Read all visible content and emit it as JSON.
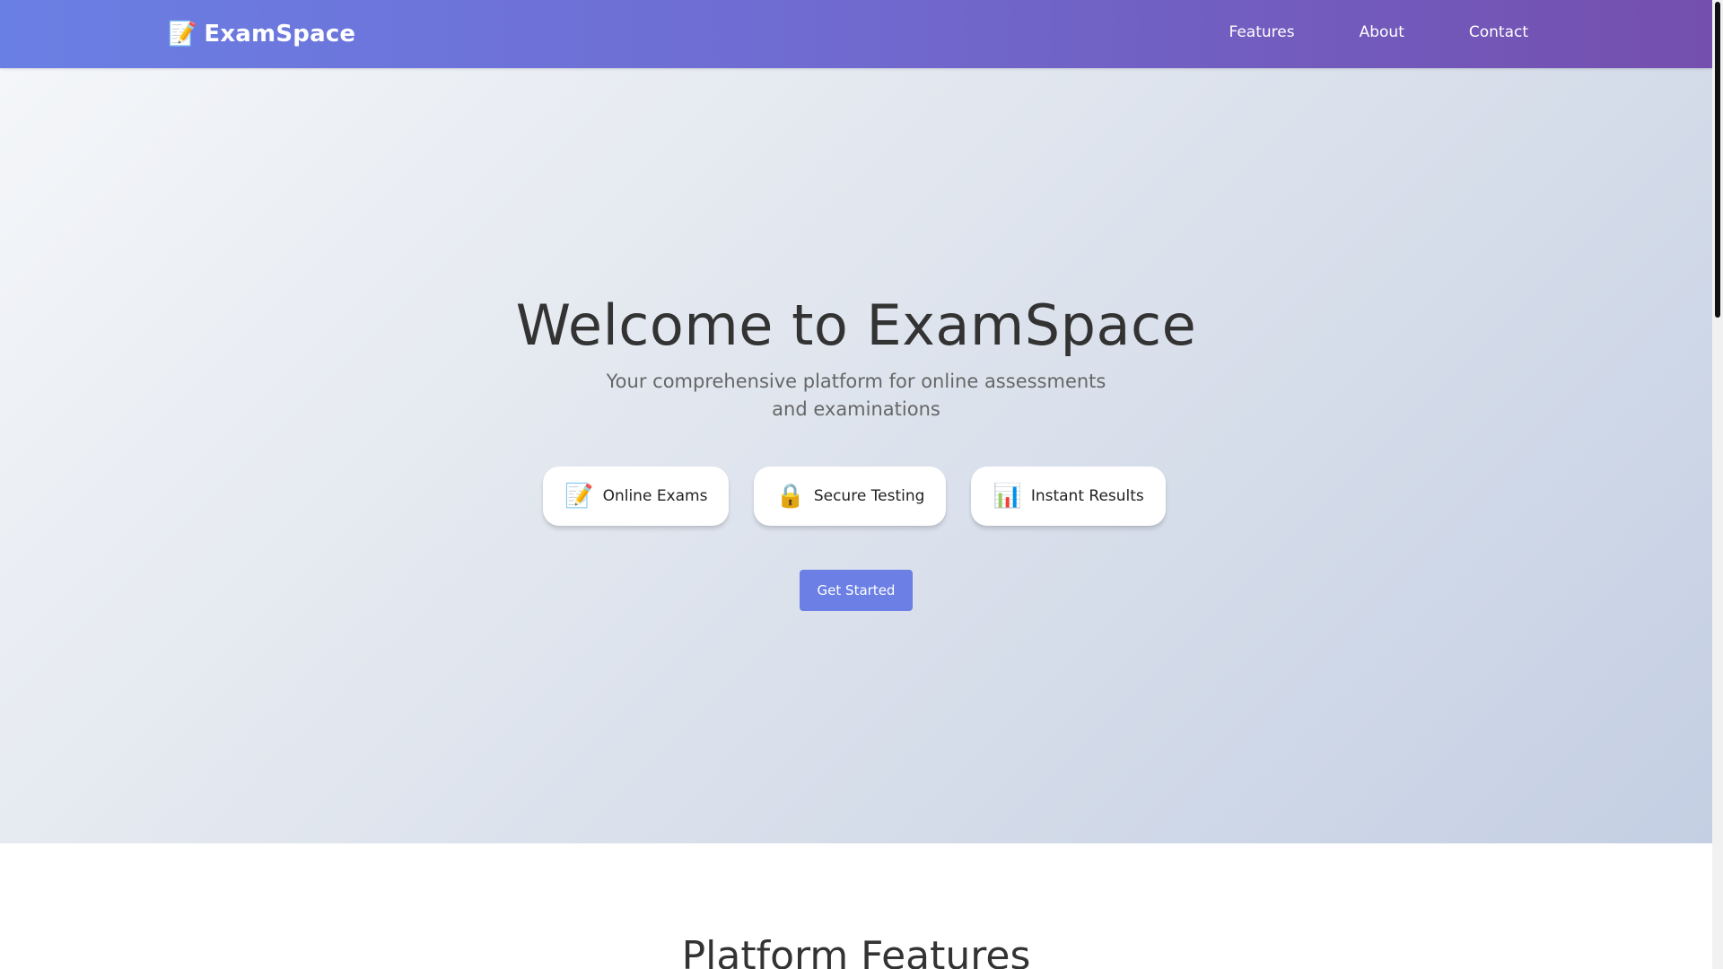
{
  "navbar": {
    "brand": {
      "icon": "memo-pencil-icon",
      "icon_glyph": "📝",
      "name": "ExamSpace"
    },
    "links": [
      {
        "label": "Features"
      },
      {
        "label": "About"
      },
      {
        "label": "Contact"
      }
    ],
    "gradient_start": "#6a7fe4",
    "gradient_end": "#744fae"
  },
  "hero": {
    "title": "Welcome to ExamSpace",
    "subtitle": "Your comprehensive platform for online assessments and examinations",
    "features": [
      {
        "icon": "memo-pencil-icon",
        "glyph": "📝",
        "label": "Online Exams"
      },
      {
        "icon": "lock-icon",
        "glyph": "🔒",
        "label": "Secure Testing"
      },
      {
        "icon": "bar-chart-icon",
        "glyph": "📊",
        "label": "Instant Results"
      }
    ],
    "cta_label": "Get Started",
    "cta_color": "#6b7fe4"
  },
  "features_section": {
    "title": "Platform Features"
  }
}
